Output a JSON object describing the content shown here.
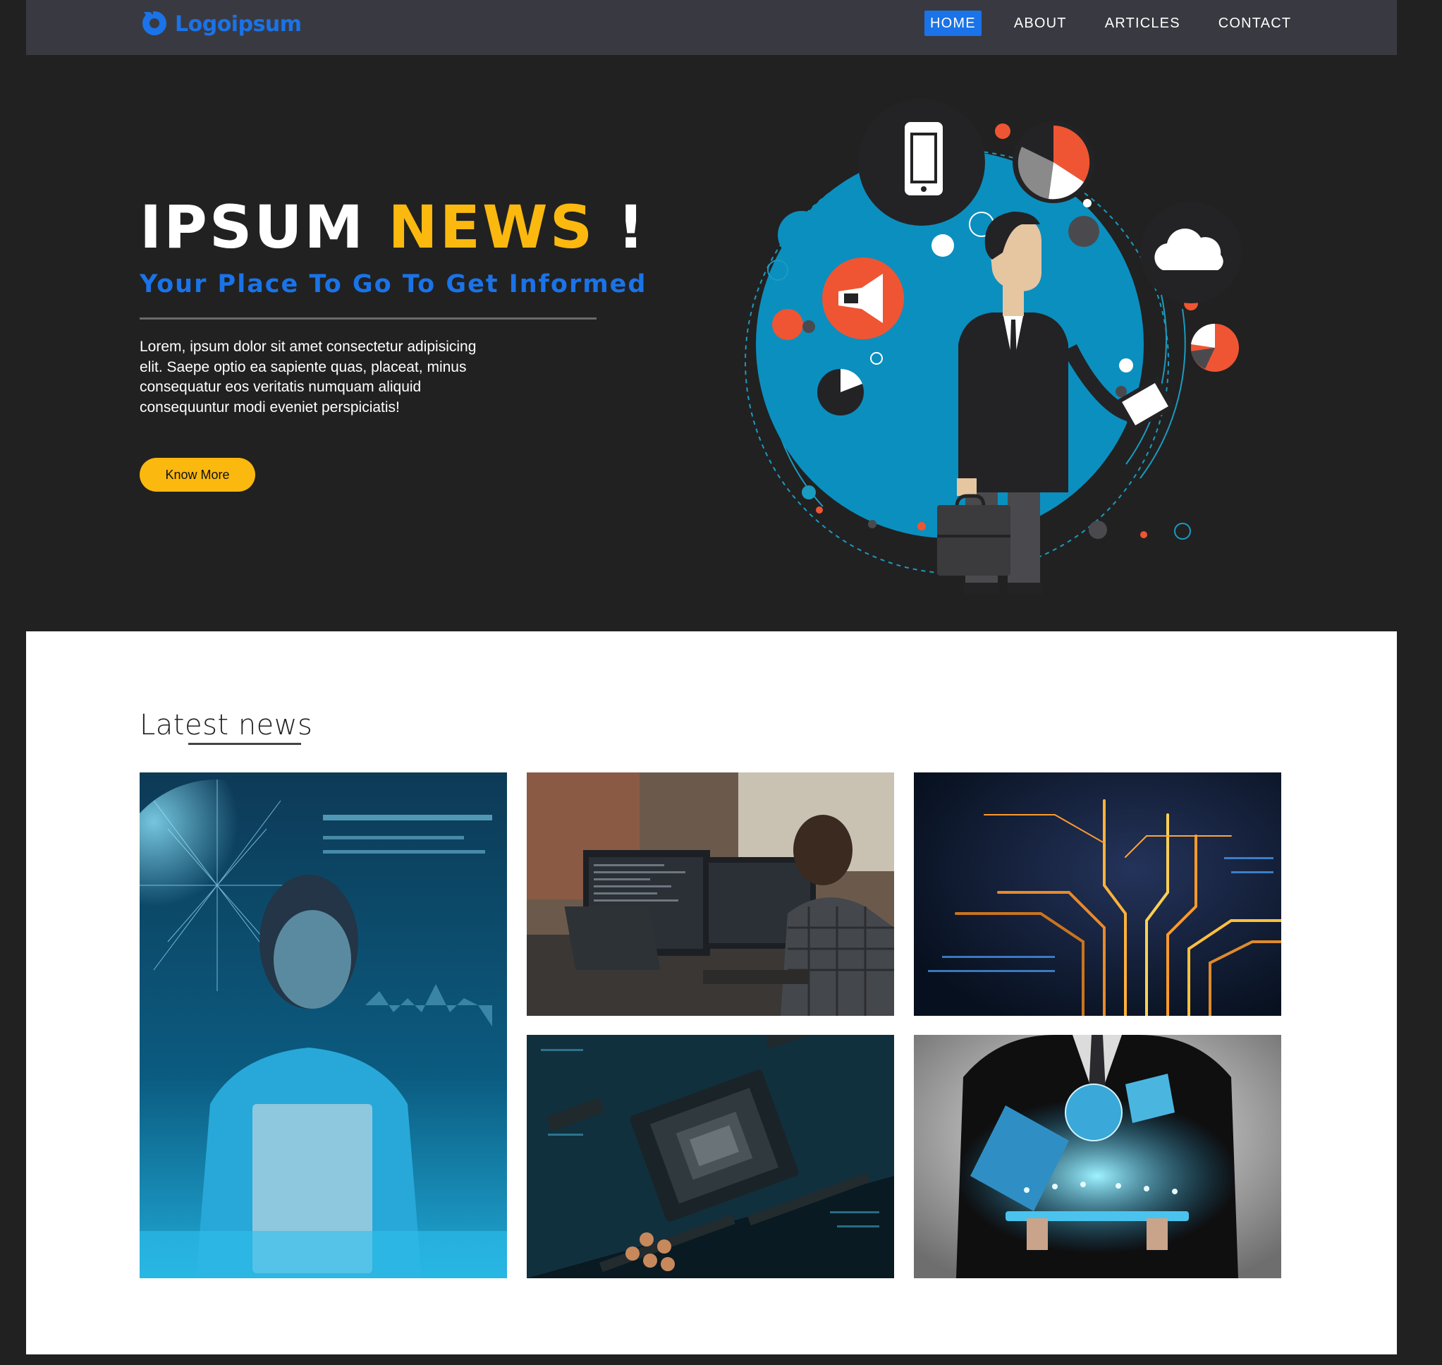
{
  "nav": {
    "logo_text": "Logoipsum",
    "items": [
      {
        "label": "HOME",
        "active": true
      },
      {
        "label": "ABOUT"
      },
      {
        "label": "ARTICLES"
      },
      {
        "label": "CONTACT"
      }
    ]
  },
  "hero": {
    "title_main": "IPSUM ",
    "title_accent": "NEWS",
    "title_end": " !",
    "subtitle": "Your Place To Go To Get Informed",
    "body": "Lorem, ipsum dolor sit amet consectetur adipisicing elit. Saepe optio ea sapiente quas, placeat, minus consequatur eos veritatis numquam aliquid consequuntur modi eveniet perspiciatis!",
    "button_label": "Know More"
  },
  "news": {
    "heading": "Latest news"
  },
  "colors": {
    "accent_blue": "#1a73e8",
    "accent_yellow": "#fbb80f",
    "nav_bg": "#393a41",
    "hero_bg": "#212121"
  }
}
